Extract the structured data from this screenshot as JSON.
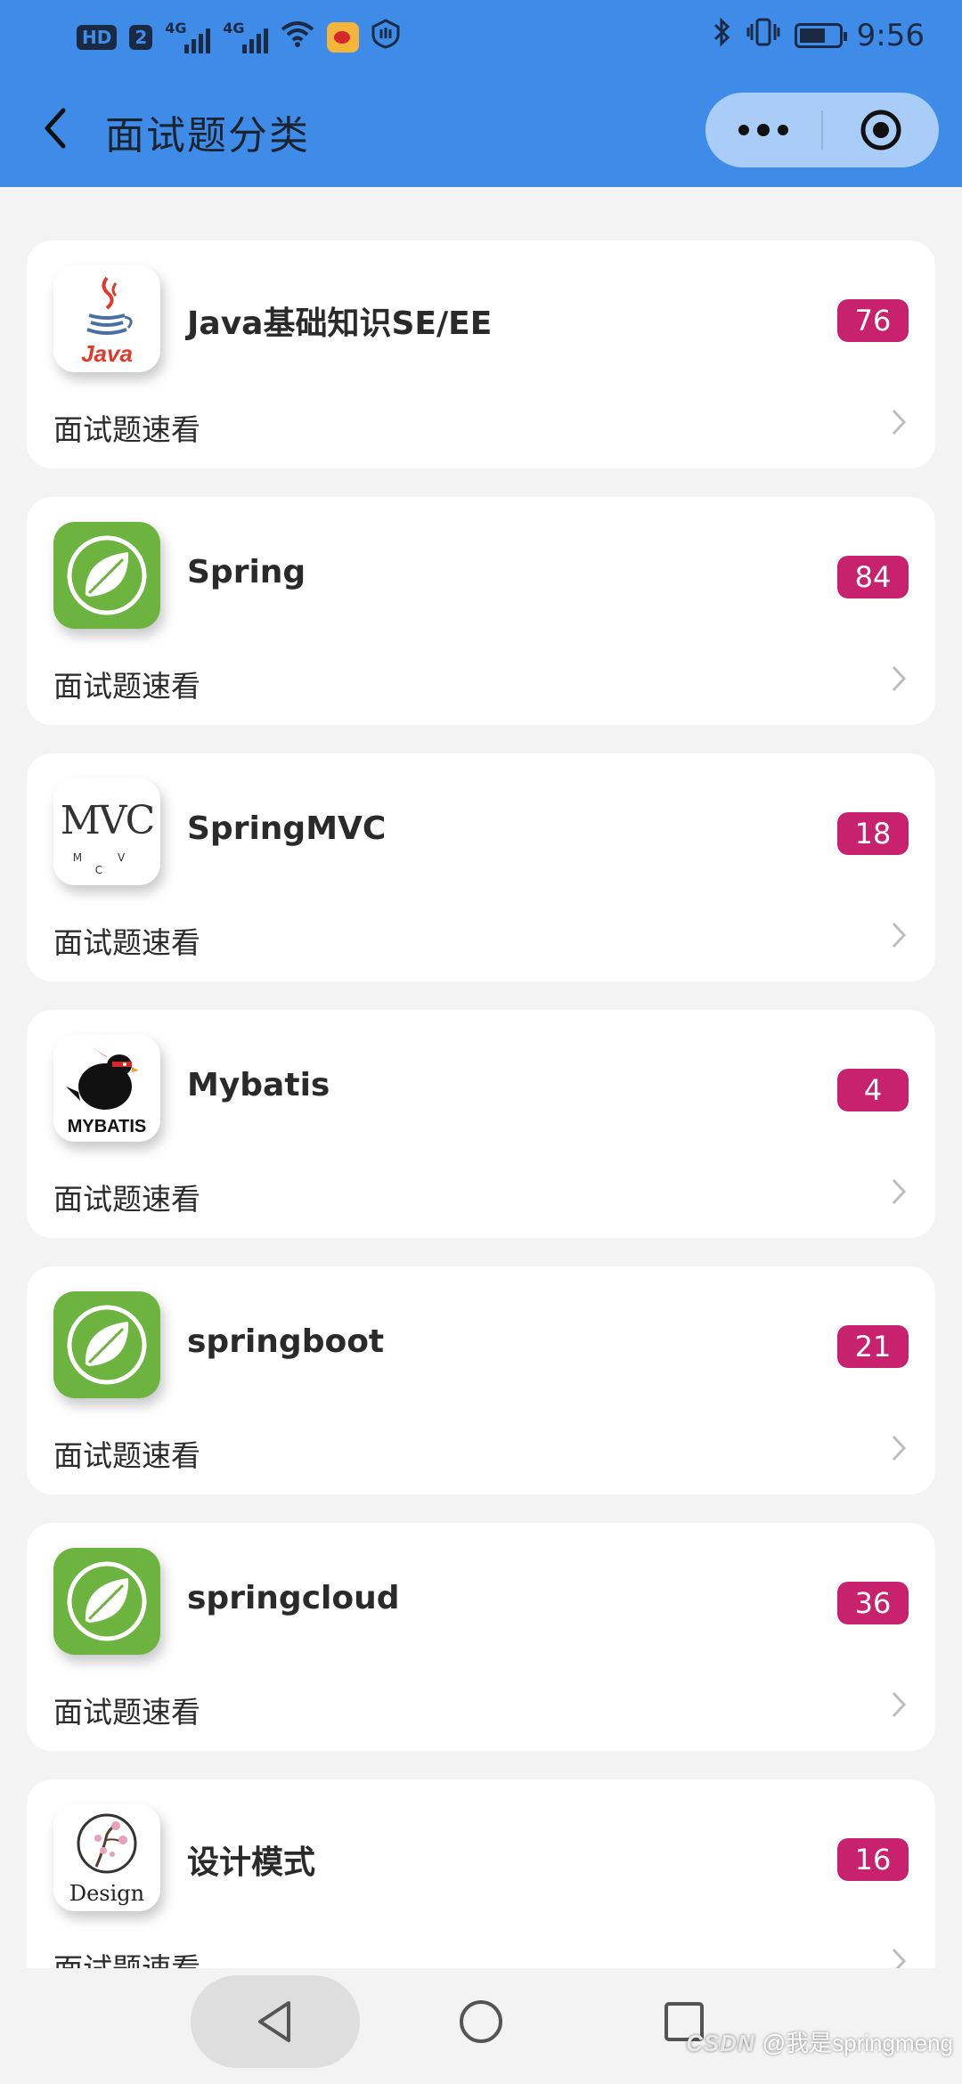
{
  "status_bar": {
    "hd_badge": "HD",
    "sim_badge": "2",
    "network_1": "4G",
    "network_2": "4G",
    "time": "9:56",
    "icons": [
      "signal-icon",
      "wifi-icon",
      "weibo-icon",
      "shield-icon",
      "bluetooth-icon",
      "vibrate-icon",
      "battery-icon"
    ]
  },
  "nav": {
    "title": "面试题分类",
    "back_icon": "chevron-left-icon",
    "more_icon": "more-dots-icon",
    "close_icon": "target-icon"
  },
  "colors": {
    "header_blue": "#3f8ce8",
    "badge_magenta": "#c8226e",
    "spring_green": "#6db33f"
  },
  "categories": [
    {
      "title": "Java基础知识SE/EE",
      "count": "76",
      "subtitle": "面试题速看",
      "icon": "java-logo-icon"
    },
    {
      "title": "Spring",
      "count": "84",
      "subtitle": "面试题速看",
      "icon": "spring-leaf-icon"
    },
    {
      "title": "SpringMVC",
      "count": "18",
      "subtitle": "面试题速看",
      "icon": "mvc-logo-icon",
      "icon_text": "MVC",
      "icon_subtext": "M V C"
    },
    {
      "title": "Mybatis",
      "count": "4",
      "subtitle": "面试题速看",
      "icon": "mybatis-bird-icon",
      "icon_text": "MYBATIS"
    },
    {
      "title": "springboot",
      "count": "21",
      "subtitle": "面试题速看",
      "icon": "spring-leaf-icon"
    },
    {
      "title": "springcloud",
      "count": "36",
      "subtitle": "面试题速看",
      "icon": "spring-leaf-icon"
    },
    {
      "title": "设计模式",
      "count": "16",
      "subtitle": "面试题速看",
      "icon": "design-blossom-icon",
      "icon_text": "Design"
    }
  ],
  "java_logo_text": "Java",
  "system_nav": {
    "back_icon": "triangle-back-icon",
    "home_icon": "circle-home-icon",
    "recent_icon": "square-recent-icon"
  },
  "watermark": {
    "brand": "CSDN",
    "text": "@我是springmeng"
  }
}
